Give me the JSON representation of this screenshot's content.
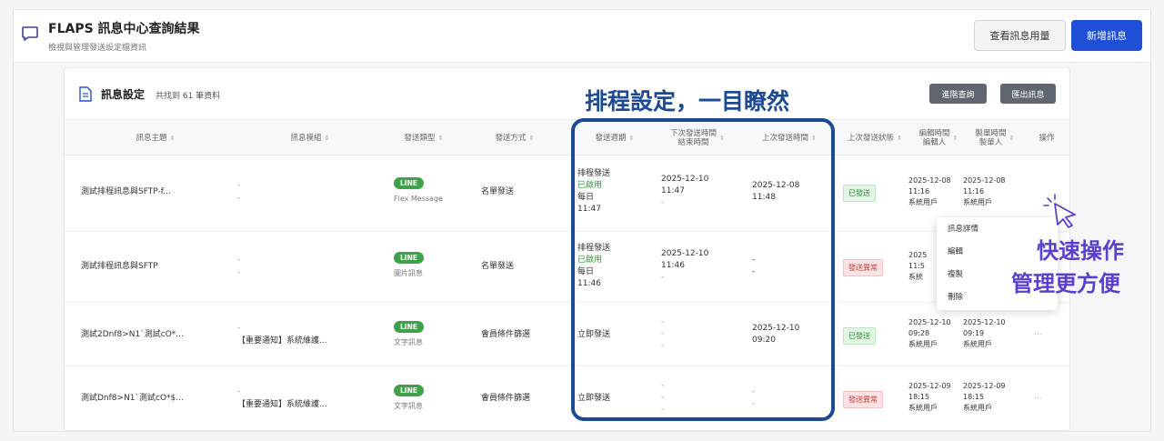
{
  "header": {
    "title": "FLAPS 訊息中心查詢結果",
    "subtitle": "檢視與管理發送設定檔資訊",
    "usage_button": "查看訊息用量",
    "new_button": "新增訊息"
  },
  "card": {
    "title": "訊息設定",
    "count": "共找到 61 筆資料",
    "adv_search": "進階查詢",
    "export": "匯出訊息"
  },
  "columns": {
    "subject": "訊息主題",
    "template": "訊息模組",
    "type": "發送類型",
    "method": "發送方式",
    "period": "發送週期",
    "next_time": "下次發送時間",
    "end_time": "結束時間",
    "last_time": "上次發送時間",
    "last_status": "上次發送狀態",
    "edit_time": "編輯時間",
    "editor": "編輯人",
    "create_time": "製單時間",
    "creator": "製單人",
    "action": "操作"
  },
  "rows": [
    {
      "subject": "測試排程訊息與SFTP-f...",
      "tpl1": "-",
      "tpl2": "-",
      "badge": "LINE",
      "fmt": "Flex Message",
      "method": "名單發送",
      "p1": "排程發送",
      "p2": "已啟用",
      "p3": "每日",
      "p4": "11:47",
      "next": "2025-12-10",
      "next2": "11:47",
      "end": "-",
      "last": "2025-12-08",
      "last2": "11:48",
      "status": "已發送",
      "status_kind": "ok",
      "edit": "2025-12-08",
      "edit2": "11:16",
      "editor": "系統用戶",
      "create": "2025-12-08",
      "create2": "11:16",
      "creator": "系統用戶",
      "op": ""
    },
    {
      "subject": "測試排程訊息與SFTP",
      "tpl1": "-",
      "tpl2": "-",
      "badge": "LINE",
      "fmt": "圖片訊息",
      "method": "名單發送",
      "p1": "排程發送",
      "p2": "已啟用",
      "p3": "每日",
      "p4": "11:46",
      "next": "2025-12-10",
      "next2": "11:46",
      "end": "-",
      "last": "-",
      "last2": "-",
      "status": "發送異常",
      "status_kind": "err",
      "edit": "2025",
      "edit2": "11:5",
      "editor": "系統",
      "create": "",
      "create2": "",
      "creator": "",
      "op": ""
    },
    {
      "subject": "測試2Dnf8>N1`測試cO*...",
      "tpl1": "-",
      "tpl2": "【重要通知】系統維護...",
      "badge": "LINE",
      "fmt": "文字訊息",
      "method": "會員條件篩選",
      "p1": "立即發送",
      "p2": "",
      "p3": "",
      "p4": "",
      "next": "-",
      "next2": "-",
      "end": "-",
      "last": "2025-12-10",
      "last2": "09:20",
      "status": "已發送",
      "status_kind": "ok",
      "edit": "2025-12-10",
      "edit2": "09:28",
      "editor": "系統用戶",
      "create": "2025-12-10",
      "create2": "09:19",
      "creator": "系統用戶",
      "op": "..."
    },
    {
      "subject": "測試Dnf8>N1`測試cO*$...",
      "tpl1": "-",
      "tpl2": "【重要通知】系統維護...",
      "badge": "LINE",
      "fmt": "文字訊息",
      "method": "會員條件篩選",
      "p1": "立即發送",
      "p2": "",
      "p3": "",
      "p4": "",
      "next": "-",
      "next2": "-",
      "end": "-",
      "last": "-",
      "last2": "-",
      "status": "發送異常",
      "status_kind": "err",
      "edit": "2025-12-09",
      "edit2": "18:15",
      "editor": "系統用戶",
      "create": "2025-12-09",
      "create2": "18:15",
      "creator": "系統用戶",
      "op": "..."
    }
  ],
  "menu": {
    "detail": "訊息詳情",
    "edit": "編輯",
    "copy": "複製",
    "delete": "刪除"
  },
  "annotations": {
    "schedule": "排程設定，一目瞭然",
    "quick1": "快速操作",
    "quick2": "管理更方便"
  },
  "colors": {
    "primary": "#1f4fd6",
    "highlight": "#1c4a94",
    "callout": "#5b3fd0",
    "line_green": "#3fa24a"
  }
}
